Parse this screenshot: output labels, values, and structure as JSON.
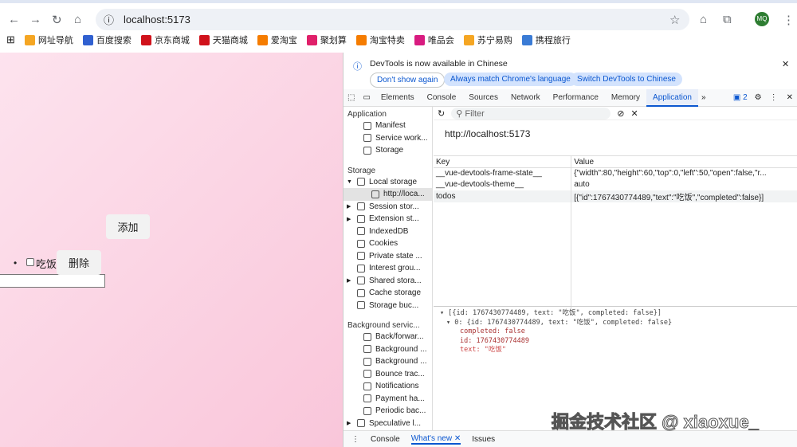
{
  "browser": {
    "url": "localhost:5173",
    "profile": "MQ",
    "bookmarks": [
      {
        "label": "网址导航",
        "color": "#f5a623"
      },
      {
        "label": "百度搜索",
        "color": "#3060d0"
      },
      {
        "label": "京东商城",
        "color": "#d0121b"
      },
      {
        "label": "天猫商城",
        "color": "#d0121b"
      },
      {
        "label": "爱淘宝",
        "color": "#f57c00"
      },
      {
        "label": "聚划算",
        "color": "#e0206a"
      },
      {
        "label": "淘宝特卖",
        "color": "#f57c00"
      },
      {
        "label": "唯品会",
        "color": "#d81b80"
      },
      {
        "label": "苏宁易购",
        "color": "#f5a623"
      },
      {
        "label": "携程旅行",
        "color": "#3a7bd5"
      }
    ]
  },
  "app": {
    "add_button": "添加",
    "input_value": "",
    "todo": {
      "text": "吃饭",
      "completed": false,
      "delete_button": "删除"
    }
  },
  "devtools": {
    "info": {
      "message": "DevTools is now available in Chinese",
      "dont_show": "Don't show again",
      "match": "Always match Chrome's language",
      "switch": "Switch DevTools to Chinese"
    },
    "tabs": [
      "Elements",
      "Console",
      "Sources",
      "Network",
      "Performance",
      "Memory",
      "Application"
    ],
    "active_tab": "Application",
    "badge": "2",
    "sidebar": {
      "app_header": "Application",
      "app_items": [
        "Manifest",
        "Service work...",
        "Storage"
      ],
      "storage_header": "Storage",
      "storage_items": [
        "Local storage",
        "http://loca...",
        "Session stor...",
        "Extension st...",
        "IndexedDB",
        "Cookies",
        "Private state ...",
        "Interest grou...",
        "Shared stora...",
        "Cache storage",
        "Storage buc..."
      ],
      "bg_header": "Background servic...",
      "bg_items": [
        "Back/forwar...",
        "Background ...",
        "Background ...",
        "Bounce trac...",
        "Notifications",
        "Payment ha...",
        "Periodic bac...",
        "Speculative l..."
      ]
    },
    "filter_placeholder": "Filter",
    "origin": "http://localhost:5173",
    "table": {
      "headers": [
        "Key",
        "Value"
      ],
      "rows": [
        [
          "__vue-devtools-frame-state__",
          "{\"width\":80,\"height\":60,\"top\":0,\"left\":50,\"open\":false,\"r..."
        ],
        [
          "__vue-devtools-theme__",
          "auto"
        ],
        [
          "todos",
          "[{\"id\":1767430774489,\"text\":\"吃饭\",\"completed\":false}]"
        ]
      ]
    },
    "preview": {
      "line1": "[{id: 1767430774489, text: \"吃饭\", completed: false}]",
      "line2": "0: {id: 1767430774489, text: \"吃饭\", completed: false}",
      "completed": "completed: false",
      "id": "id: 1767430774489",
      "text": "text: \"吃饭\""
    },
    "drawer": {
      "tabs": [
        "Console",
        "What's new",
        "Issues"
      ]
    }
  },
  "watermark": "掘金技术社区 @ xiaoxue_"
}
